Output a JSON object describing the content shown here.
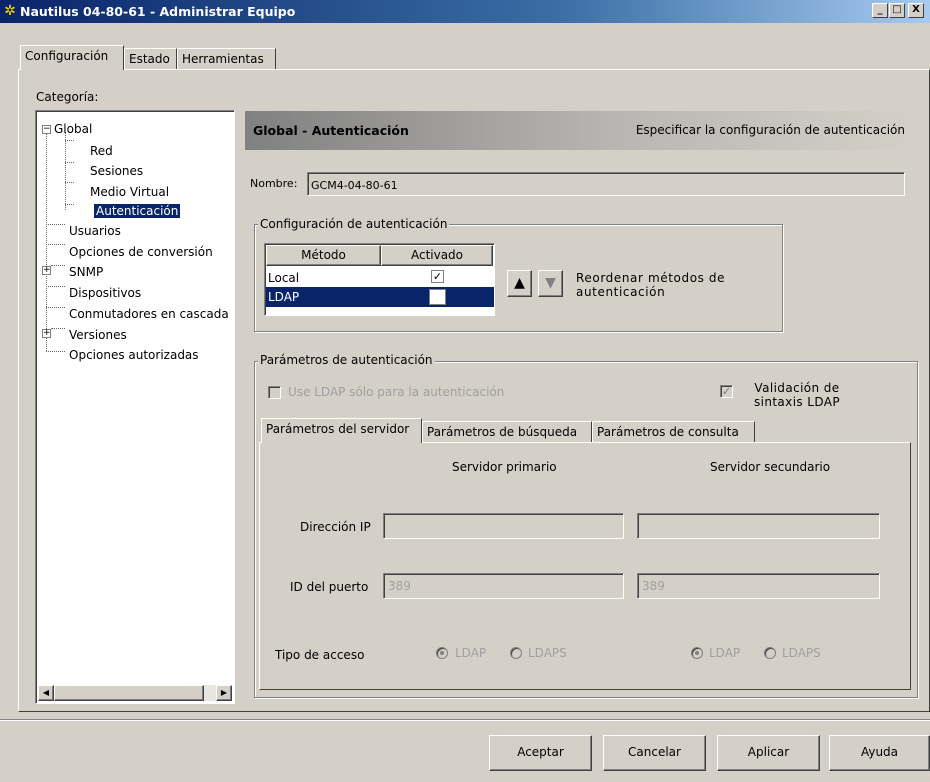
{
  "window": {
    "title": "Nautilus 04-80-61 - Administrar Equipo",
    "minimize": "_",
    "maximize": "□",
    "close": "X",
    "icon": "app-icon"
  },
  "tabs": [
    "Configuración",
    "Estado",
    "Herramientas"
  ],
  "category_label": "Categoría:",
  "tree": {
    "global": "Global",
    "red": "Red",
    "sesiones": "Sesiones",
    "medio_virtual": "Medio Virtual",
    "autenticacion": "Autenticación",
    "usuarios": "Usuarios",
    "opciones_conversion": "Opciones de conversión",
    "snmp": "SNMP",
    "dispositivos": "Dispositivos",
    "conmutadores": "Conmutadores en cascada",
    "versiones": "Versiones",
    "opciones_autorizadas": "Opciones autorizadas",
    "expand_minus": "−",
    "expand_plus": "+"
  },
  "header": {
    "title": "Global - Autenticación",
    "description": "Especificar la configuración de autenticación"
  },
  "nombre": {
    "label": "Nombre:",
    "value": "GCM4-04-80-61"
  },
  "auth_config": {
    "group_label": "Configuración de autenticación",
    "col_method": "Método",
    "col_enabled": "Activado",
    "rows": [
      {
        "method": "Local",
        "enabled": "✓"
      },
      {
        "method": "LDAP",
        "enabled": ""
      }
    ],
    "reorder_label": "Reordenar métodos de autenticación",
    "up_arrow": "▲",
    "down_arrow": "▼"
  },
  "auth_params": {
    "group_label": "Parámetros de autenticación",
    "use_ldap_only": "Use LDAP sólo para la autenticación",
    "ldap_syntax": "Validación de sintaxis LDAP",
    "check_mark": "✓",
    "subtabs": [
      "Parámetros del servidor",
      "Parámetros de búsqueda",
      "Parámetros de consulta"
    ],
    "primary": "Servidor primario",
    "secondary": "Servidor secundario",
    "ip_label": "Dirección IP",
    "port_label": "ID del puerto",
    "port_primary": "389",
    "port_secondary": "389",
    "access_label": "Tipo de acceso",
    "opt_ldap": "LDAP",
    "opt_ldaps": "LDAPS"
  },
  "buttons": {
    "accept": "Aceptar",
    "cancel": "Cancelar",
    "apply": "Aplicar",
    "help": "Ayuda"
  },
  "scroll": {
    "left": "◀",
    "right": "▶"
  },
  "colors": {
    "selection": "#0a246a",
    "header_bg": "#808080"
  }
}
